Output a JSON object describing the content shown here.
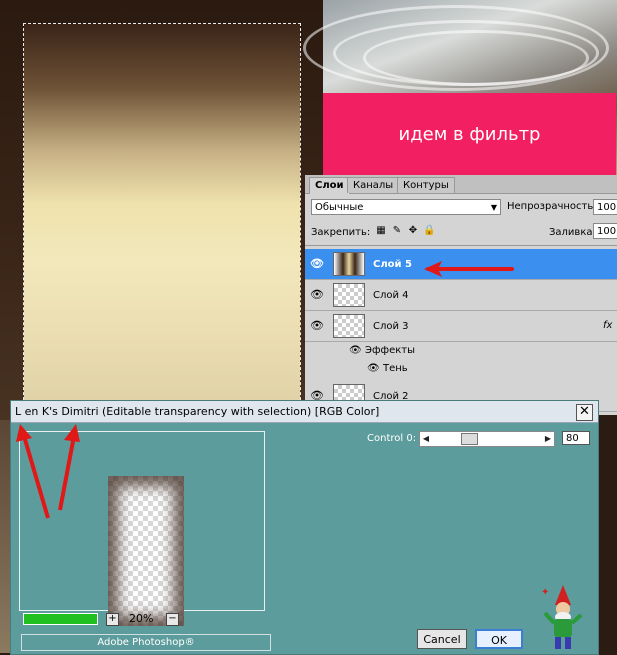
{
  "banner": {
    "text": "идем в фильтр"
  },
  "layers_panel": {
    "tabs": [
      "Слои",
      "Каналы",
      "Контуры"
    ],
    "blend_mode": "Обычные",
    "opacity_label": "Непрозрачность:",
    "opacity_value": "100",
    "lock_label": "Закрепить:",
    "fill_label": "Заливка:",
    "fill_value": "100",
    "layers": [
      {
        "name": "Слой 5",
        "selected": true
      },
      {
        "name": "Слой 4",
        "selected": false
      },
      {
        "name": "Слой 3",
        "selected": false,
        "fx": "fx"
      },
      {
        "name": "Слой 2",
        "selected": false
      }
    ],
    "effects_label": "Эффекты",
    "shadow_label": "Тень"
  },
  "dialog": {
    "title": "L en K's Dimitri (Editable transparency with selection) [RGB Color]",
    "close_glyph": "✕",
    "control_label": "Control 0:",
    "control_value": "80",
    "control_level": 0.31,
    "zoom_value": "20%",
    "zoom_in": "+",
    "zoom_out": "−",
    "footer_label": "Adobe Photoshop®",
    "cancel_label": "Cancel",
    "ok_label": "OK"
  },
  "colors": {
    "banner": "#f21f62",
    "selected_layer": "#3a8fef",
    "dialog_bg": "#5d9c9c",
    "arrow": "#e01818"
  },
  "icons": {
    "eye": "eye-icon",
    "lock_transparency": "checker-lock-icon",
    "lock_brush": "brush-icon",
    "lock_move": "move-icon",
    "lock_all": "padlock-icon"
  }
}
